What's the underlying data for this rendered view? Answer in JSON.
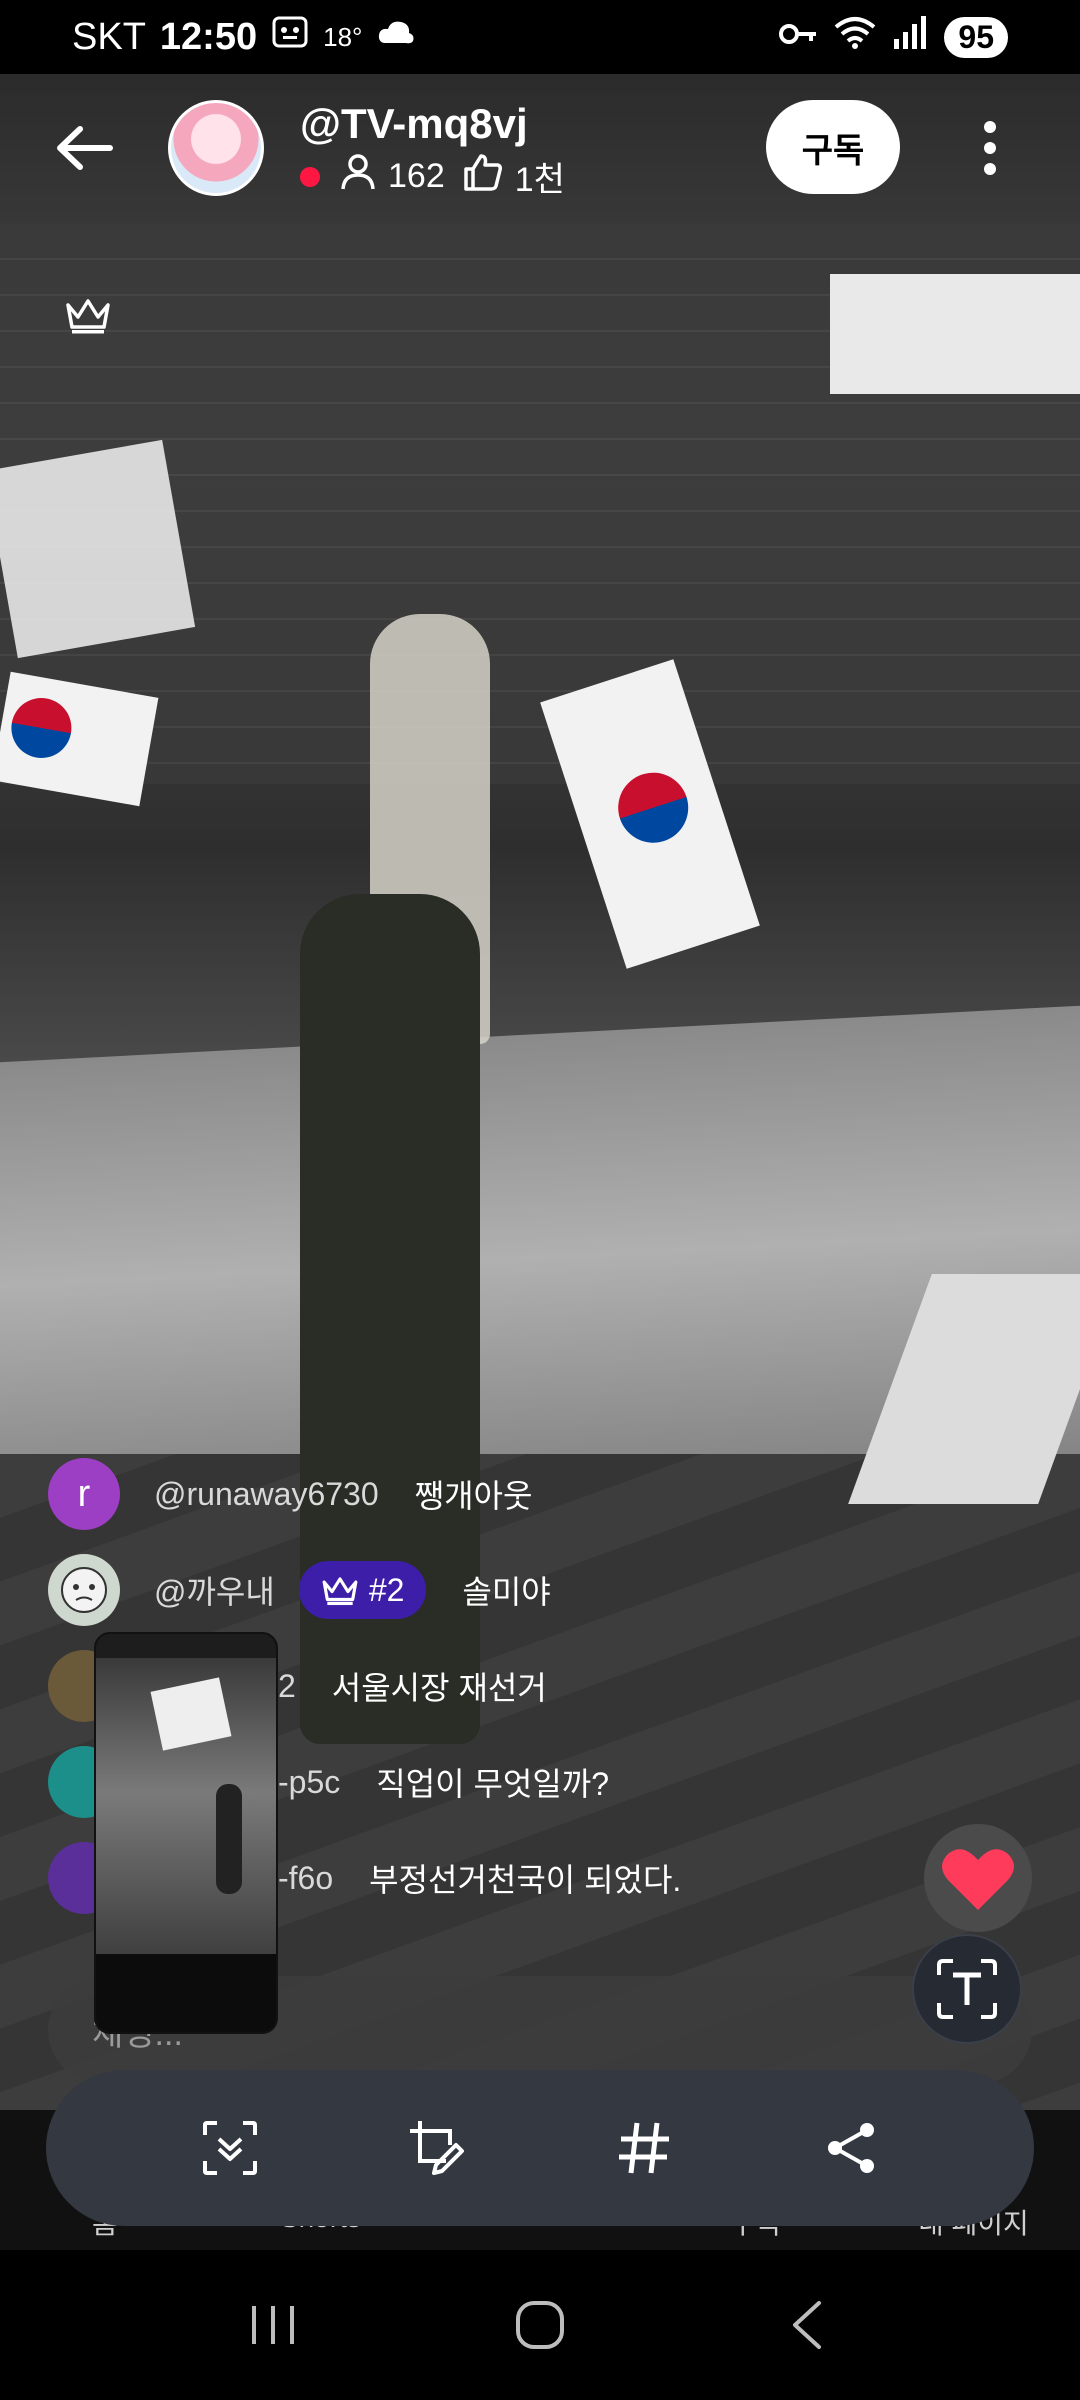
{
  "status_bar": {
    "carrier": "SKT",
    "time": "12:50",
    "temperature": "18°",
    "battery": "95"
  },
  "header": {
    "channel_name": "@TV-mq8vj",
    "viewers": "162",
    "likes": "1천",
    "subscribe_label": "구독"
  },
  "chat": {
    "messages": [
      {
        "avatar_letter": "r",
        "avatar_color": "#9c3fc4",
        "user": "@runaway6730",
        "text": "쨍개아웃"
      },
      {
        "avatar_letter": "",
        "avatar_color": "#cfd8cf",
        "user": "@까우내",
        "badge": "#2",
        "text": "솔미야"
      },
      {
        "avatar_letter": "",
        "avatar_color": "#6a5a3a",
        "user": "2",
        "text": "서울시장 재선거"
      },
      {
        "avatar_letter": "",
        "avatar_color": "#1c8f8a",
        "user": "-p5c",
        "text": "직업이 무엇일까?"
      },
      {
        "avatar_letter": "",
        "avatar_color": "#5a2f9a",
        "user": "-f6o",
        "text": "부정선거천국이 되었다."
      }
    ],
    "input_placeholder": "채팅..."
  },
  "app_nav": {
    "items": [
      "홈",
      "Shorts",
      "구독",
      "내 페이지"
    ]
  },
  "colors": {
    "live": "#ff1744",
    "badge": "#3d1ea8",
    "heart": "#ff3b5c",
    "toolbar": "#343841"
  }
}
